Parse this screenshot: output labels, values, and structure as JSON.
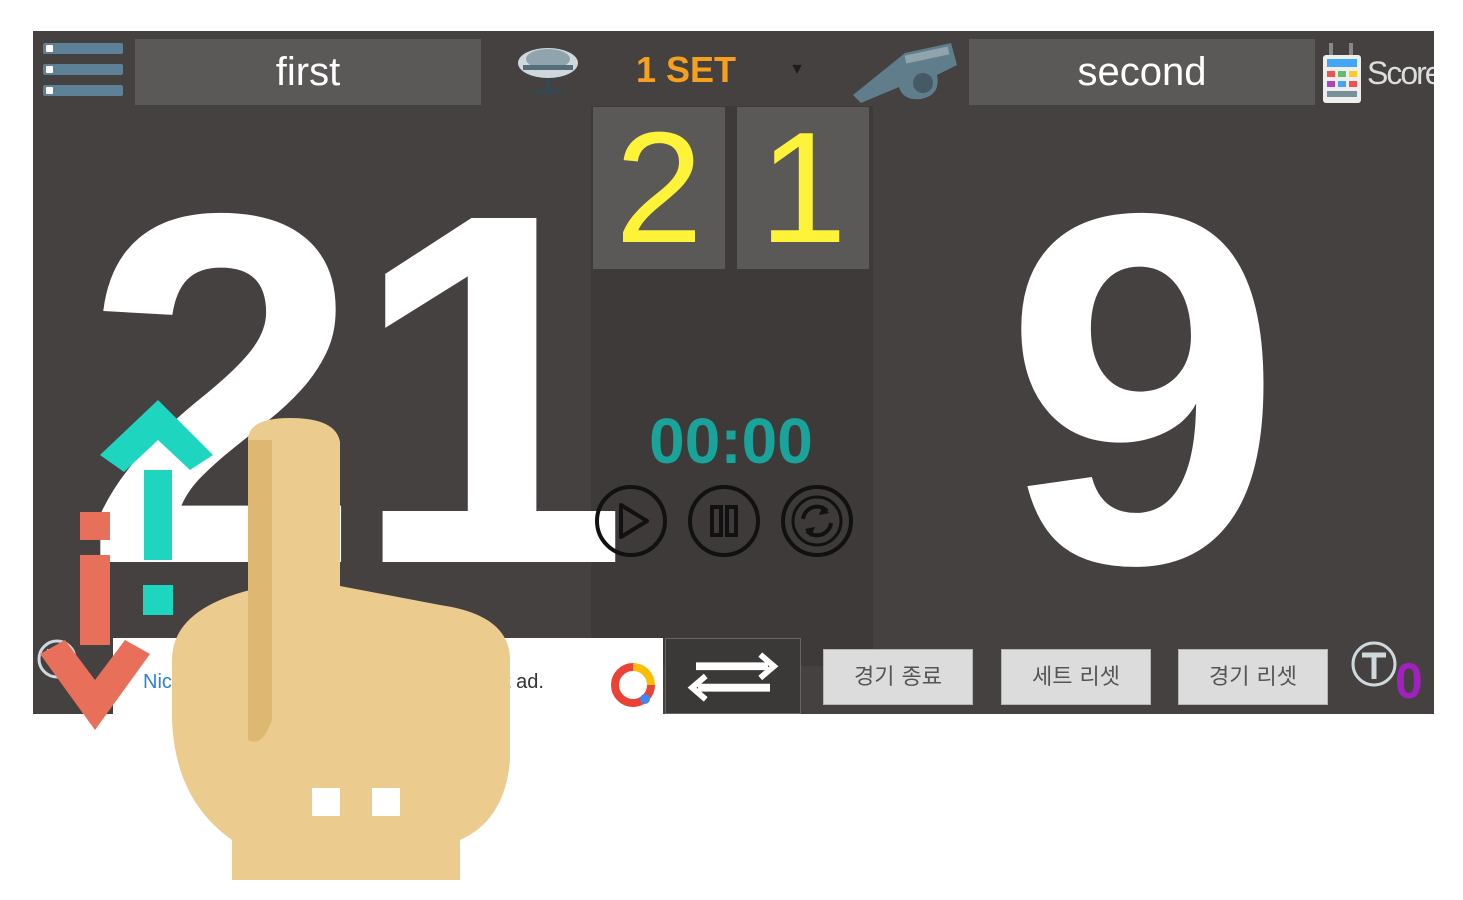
{
  "header": {
    "team_left": "first",
    "team_right": "second",
    "set_label": "1 SET",
    "score_icon_label": "Score"
  },
  "scores": {
    "left": "21",
    "right": "9"
  },
  "sets": {
    "left": "2",
    "right": "1"
  },
  "timer": {
    "value": "00:00"
  },
  "ad": {
    "left_text": "Nic",
    "right_text": "t ad."
  },
  "buttons": {
    "end_game": "경기 종료",
    "set_reset": "세트 리셋",
    "game_reset": "경기 리셋"
  },
  "timeouts": {
    "right_count": "0"
  },
  "icons": {
    "menu": "menu-icon",
    "microphone": "microphone-icon",
    "whistle": "whistle-icon",
    "score_keypad": "scoreboard-icon",
    "play": "play-icon",
    "pause": "pause-icon",
    "reset": "refresh-icon",
    "swap": "swap-arrows-icon",
    "timeout": "timeout-t-icon"
  },
  "colors": {
    "background": "#444140",
    "set_label": "#f5a11f",
    "set_digits": "#fff33a",
    "timer": "#1aa39b",
    "timeout_count": "#a020c0",
    "big_score": "#ffffff",
    "arrow_up": "#1ed6c0",
    "arrow_down": "#e8705a",
    "hand": "#eccb8e"
  }
}
